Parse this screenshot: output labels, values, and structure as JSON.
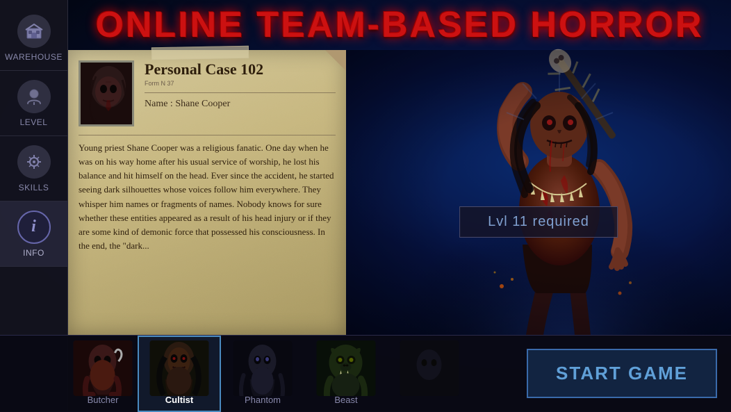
{
  "app": {
    "title": "ONLINE TEAM-BASED HORROR",
    "accent_red": "#cc1111",
    "accent_blue": "#60a0d8"
  },
  "sidebar": {
    "items": [
      {
        "id": "warehouse",
        "label": "Warehouse",
        "icon": "🎒",
        "active": false
      },
      {
        "id": "level",
        "label": "Level",
        "icon": "👤",
        "active": false
      },
      {
        "id": "skills",
        "label": "Skills",
        "icon": "⚙️",
        "active": false
      },
      {
        "id": "info",
        "label": "Info",
        "icon": "i",
        "active": true
      }
    ]
  },
  "case_file": {
    "title": "Personal Case 102",
    "form_note": "Form N 37",
    "name_label": "Name : Shane Cooper",
    "divider": true,
    "body_text": "Young priest Shane Cooper was a religious fanatic. One day when he was on his way home after his usual service of worship, he lost his balance and hit himself on the head. Ever since the accident, he started seeing dark silhouettes whose voices follow him everywhere. They whisper him names or fragments of names. Nobody knows for sure whether these entities appeared as a result of his head injury or if they are some kind of demonic force that possessed his consciousness. In the end, the \"dark..."
  },
  "monster": {
    "level_required": "Lvl 11 required"
  },
  "characters": [
    {
      "id": "butcher",
      "label": "Butcher",
      "active": false,
      "slot": 1
    },
    {
      "id": "cultist",
      "label": "Cultist",
      "active": true,
      "slot": 2
    },
    {
      "id": "phantom",
      "label": "Phantom",
      "active": false,
      "slot": 3
    },
    {
      "id": "beast",
      "label": "Beast",
      "active": false,
      "slot": 4
    },
    {
      "id": "slot5",
      "label": "",
      "active": false,
      "slot": 5
    }
  ],
  "buttons": {
    "start_game": "START GAME"
  }
}
